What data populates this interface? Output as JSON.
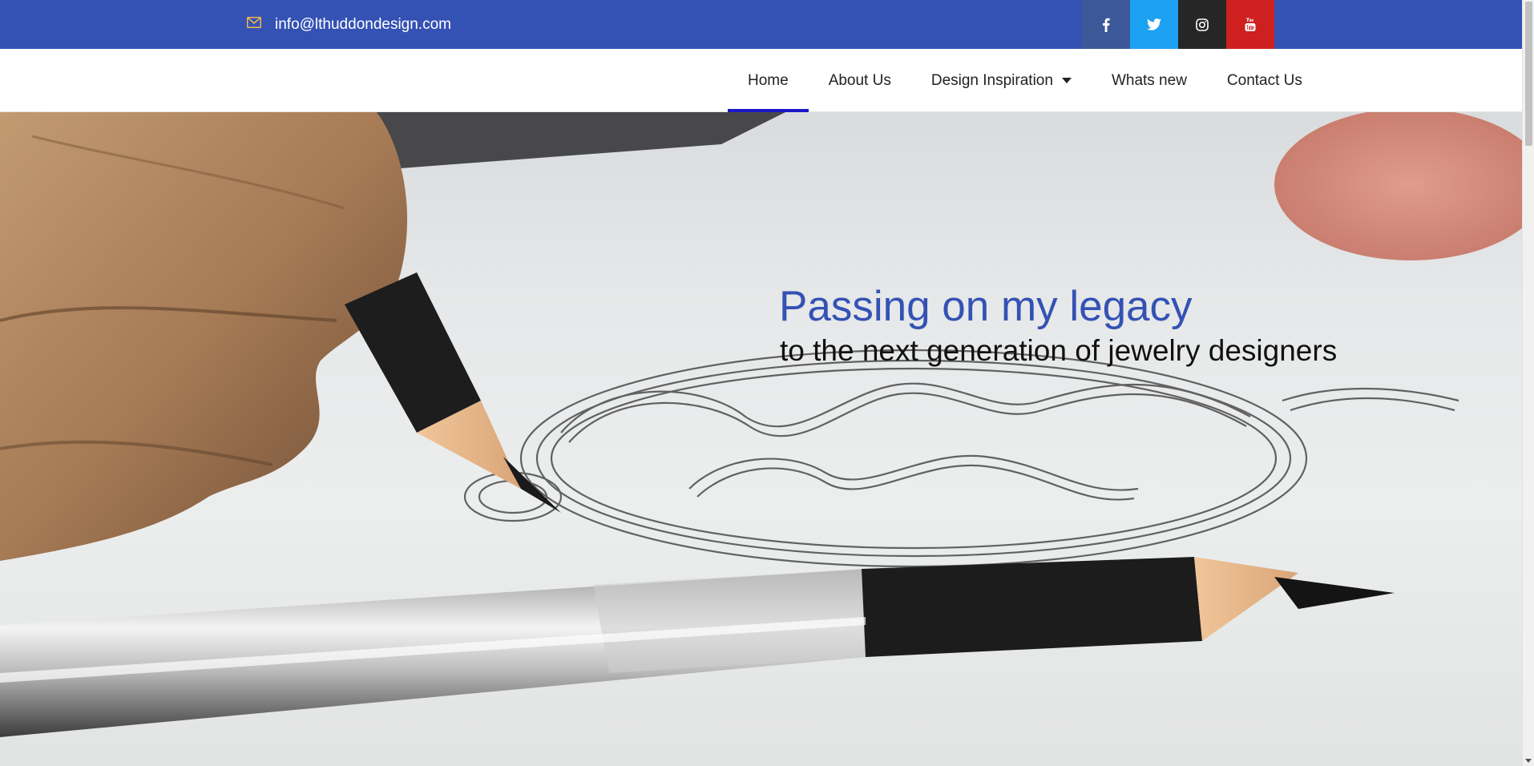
{
  "topbar": {
    "email": "info@lthuddondesign.com",
    "email_icon": "envelope-icon",
    "social": [
      {
        "name": "facebook",
        "icon": "facebook-icon",
        "color": "#3b5998"
      },
      {
        "name": "twitter",
        "icon": "twitter-icon",
        "color": "#1da1f2"
      },
      {
        "name": "instagram",
        "icon": "instagram-icon",
        "color": "#262626"
      },
      {
        "name": "youtube",
        "icon": "youtube-icon",
        "color": "#cd201f"
      }
    ],
    "background": "#3452b4"
  },
  "nav": {
    "items": [
      {
        "label": "Home",
        "active": true
      },
      {
        "label": "About Us"
      },
      {
        "label": "Design Inspiration",
        "has_dropdown": true
      },
      {
        "label": "Whats new"
      },
      {
        "label": "Contact Us"
      }
    ],
    "active_underline_color": "#1a17c9"
  },
  "hero": {
    "title": "Passing on my legacy",
    "subtitle": "to the next generation of jewelry designers",
    "title_color": "#3452b4",
    "subtitle_color": "#111111"
  }
}
